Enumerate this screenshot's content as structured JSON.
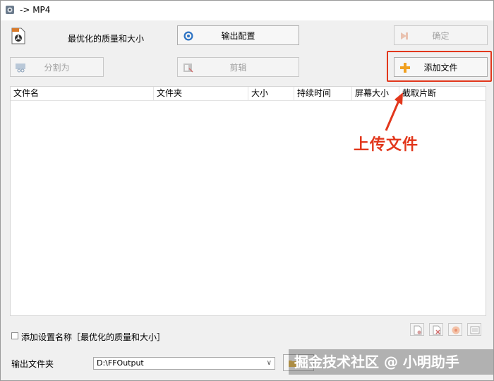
{
  "window": {
    "title": "-> MP4"
  },
  "preset": {
    "label": "最优化的质量和大小"
  },
  "buttons": {
    "output_config": "输出配置",
    "ok": "确定",
    "split": "分割为",
    "clip": "剪辑",
    "add_file": "添加文件"
  },
  "file_list": {
    "columns": [
      "文件名",
      "文件夹",
      "大小",
      "持续时间",
      "屏幕大小",
      "截取片断"
    ]
  },
  "annotation": {
    "text": "上传文件"
  },
  "options": {
    "add_setting_name_label": "添加设置名称［最优化的质量和大小］",
    "add_setting_name_checked": false
  },
  "output": {
    "folder_label": "输出文件夹",
    "folder_value": "D:\\FFOutput"
  },
  "watermark": {
    "text": "掘金技术社区 @ 小明助手"
  },
  "colors": {
    "highlight": "#e2371c",
    "add_icon": "#f0a020"
  }
}
